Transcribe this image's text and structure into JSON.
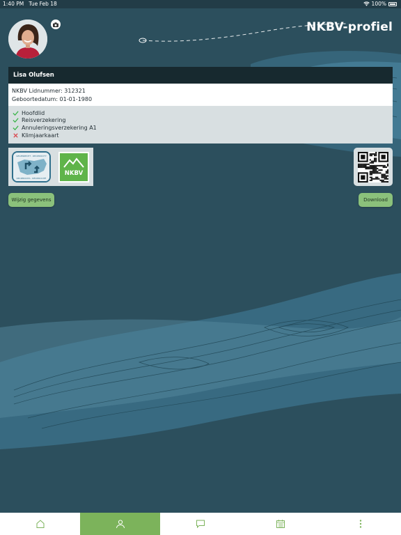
{
  "status_bar": {
    "time": "1:40 PM",
    "date": "Tue Feb 18",
    "battery": "100%"
  },
  "header": {
    "title": "NKBV-profiel"
  },
  "profile": {
    "name": "Lisa Olufsen",
    "member_number": "NKBV Lidnummer: 312321",
    "birth_date": "Geboortedatum: 01-01-1980"
  },
  "memberships": [
    {
      "label": "Hoofdlid",
      "active": true
    },
    {
      "label": "Reisverzekering",
      "active": true
    },
    {
      "label": "Annuleringsverzekering A1",
      "active": true
    },
    {
      "label": "Klimjaarkaart",
      "active": false
    }
  ],
  "badges": {
    "nkbv_label": "NKBV"
  },
  "actions": {
    "edit_label": "Wijzig gegevens",
    "download_label": "Download"
  },
  "tabs": [
    {
      "icon": "home-icon",
      "active": false
    },
    {
      "icon": "profile-icon",
      "active": true
    },
    {
      "icon": "chat-icon",
      "active": false
    },
    {
      "icon": "calendar-icon",
      "active": false
    },
    {
      "icon": "more-icon",
      "active": false
    }
  ],
  "colors": {
    "background": "#2c4f5d",
    "accent": "#7cb35b",
    "check": "#3bb54a",
    "cross": "#d9434a"
  }
}
